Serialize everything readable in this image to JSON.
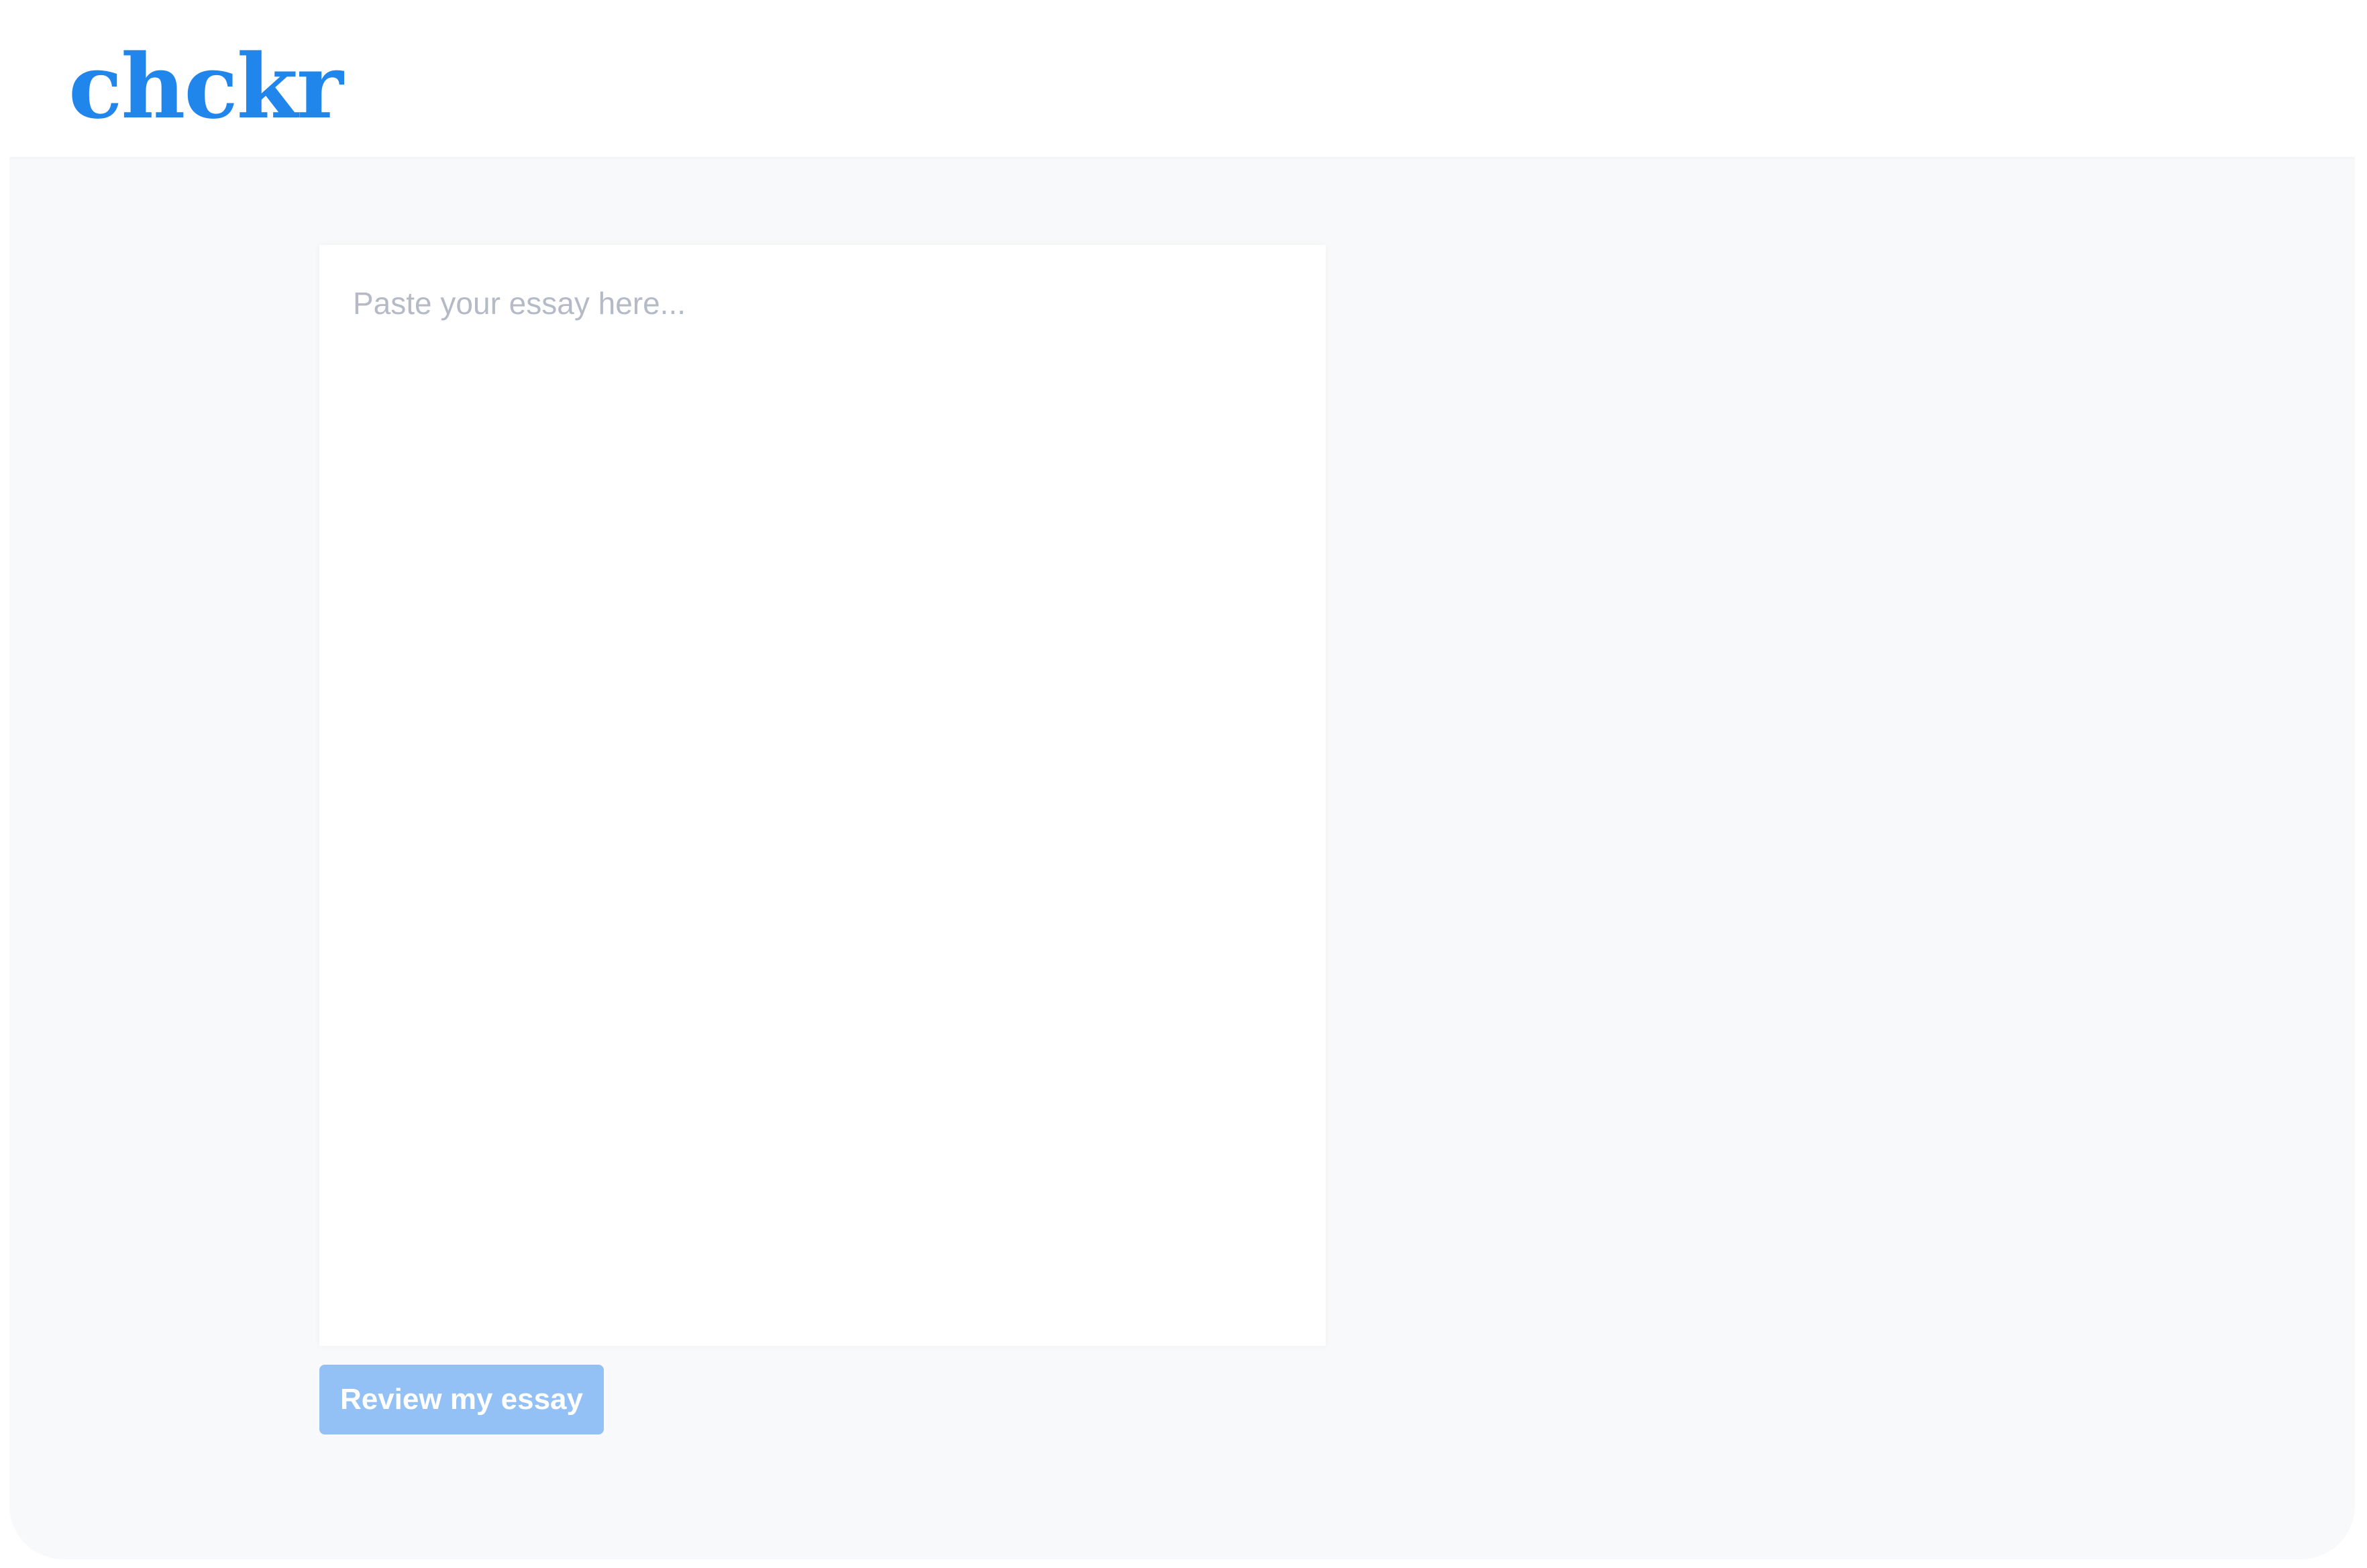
{
  "app": {
    "logo_text": "chckr",
    "brand_color": "#2186eb"
  },
  "editor": {
    "placeholder": "Paste your essay here...",
    "value": ""
  },
  "actions": {
    "review_label": "Review my essay",
    "review_button_color": "#94c1f5"
  }
}
